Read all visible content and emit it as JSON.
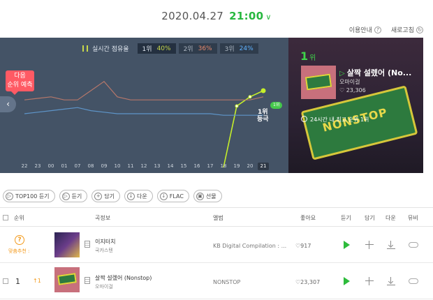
{
  "header": {
    "date": "2020.04.27",
    "time": "21:00",
    "guide": "이용안내",
    "refresh": "새로고침"
  },
  "chart": {
    "legend_title": "실시간 점유율",
    "groups": [
      {
        "rank": "1위",
        "pct": "40%",
        "color": "#c8d84a"
      },
      {
        "rank": "2위",
        "pct": "36%",
        "color": "#e98a6c"
      },
      {
        "rank": "3위",
        "pct": "24%",
        "color": "#5fb2ff"
      }
    ],
    "predict": [
      "다음",
      "순위 예측"
    ],
    "hours": [
      "22",
      "23",
      "00",
      "01",
      "07",
      "08",
      "09",
      "10",
      "11",
      "12",
      "13",
      "14",
      "15",
      "16",
      "17",
      "18",
      "19",
      "20",
      "21"
    ],
    "current_hour": "21",
    "badge": "1위",
    "rank_up": [
      "1위",
      "등극"
    ]
  },
  "chart_data": {
    "type": "line",
    "x": [
      "22",
      "23",
      "00",
      "01",
      "07",
      "08",
      "09",
      "10",
      "11",
      "12",
      "13",
      "14",
      "15",
      "16",
      "17",
      "18",
      "19",
      "20",
      "21"
    ],
    "series": [
      {
        "name": "1위",
        "values": [
          null,
          null,
          null,
          null,
          null,
          null,
          null,
          null,
          null,
          null,
          null,
          null,
          null,
          null,
          null,
          0,
          30,
          36,
          40
        ]
      },
      {
        "name": "2위",
        "values": [
          34,
          35,
          36,
          34,
          34,
          40,
          46,
          36,
          34,
          34,
          34,
          34,
          34,
          34,
          34,
          34,
          34,
          34,
          36
        ]
      },
      {
        "name": "3위",
        "values": [
          25,
          26,
          27,
          28,
          29,
          27,
          26,
          25,
          25,
          25,
          25,
          25,
          25,
          25,
          25,
          24,
          24,
          24,
          24
        ]
      }
    ]
  },
  "panel": {
    "rank": "1",
    "rank_unit": "위",
    "title": "살짝 설렜어 (No...",
    "artist": "오마이걸",
    "likes": "23,306",
    "best_label": "24시간 내 최고 순위",
    "best_value": "1위",
    "box_text": "NONSTOP"
  },
  "buttons": [
    "TOP100 듣기",
    "듣기",
    "담기",
    "다운",
    "FLAC",
    "선물"
  ],
  "table": {
    "headers": {
      "rank": "순위",
      "info": "곡정보",
      "album": "앨범",
      "likes": "좋아요",
      "listen": "듣기",
      "add": "담기",
      "down": "다운",
      "mv": "뮤비"
    },
    "rows": [
      {
        "rank": "?",
        "rank_note": "맞춤추천 :",
        "change": "",
        "title": "이지터치",
        "artist": "국카스텐",
        "album": "KB Digital Compilation : ...",
        "likes": "917"
      },
      {
        "rank": "1",
        "rank_note": "",
        "change": "1",
        "title": "살짝 설렜어 (Nonstop)",
        "artist": "오마이걸",
        "album": "NONSTOP",
        "likes": "23,307"
      }
    ]
  },
  "colors": {
    "accent": "#27b83f",
    "chart_bg": "#445366",
    "up": "#f39a1c"
  }
}
